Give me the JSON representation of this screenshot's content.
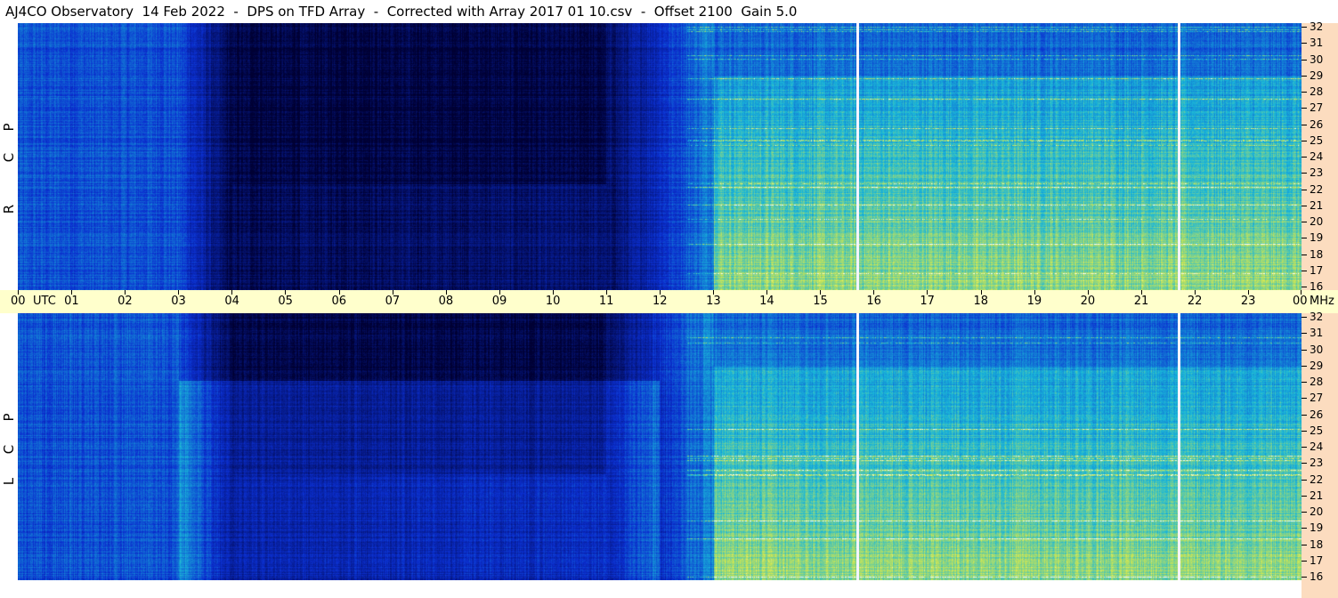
{
  "title": "AJ4CO Observatory  14 Feb 2022  -  DPS on TFD Array  -  Corrected with Array 2017 01 10.csv  -  Offset 2100  Gain 5.0",
  "chart_data": {
    "type": "heatmap",
    "panels": [
      {
        "name": "R C P",
        "letters": [
          "R",
          "C",
          "P"
        ]
      },
      {
        "name": "L C P",
        "letters": [
          "L",
          "C",
          "P"
        ]
      }
    ],
    "x_axis": {
      "ticks": [
        "00",
        "01",
        "02",
        "03",
        "04",
        "05",
        "06",
        "07",
        "08",
        "09",
        "10",
        "11",
        "12",
        "13",
        "14",
        "15",
        "16",
        "17",
        "18",
        "19",
        "20",
        "21",
        "22",
        "23",
        "00"
      ],
      "unit_label": "UTC",
      "range": [
        0,
        24
      ]
    },
    "y_axis": {
      "ticks": [
        "16",
        "17",
        "18",
        "19",
        "20",
        "21",
        "22",
        "23",
        "24",
        "25",
        "26",
        "27",
        "28",
        "29",
        "30",
        "31",
        "32"
      ],
      "unit_label": "MHz",
      "range": [
        16,
        32
      ]
    },
    "gaps_utc": [
      15.7,
      21.7
    ],
    "colors": {
      "quiet": "#000033",
      "low": "#0b2fd0",
      "mid": "#19b7d9",
      "high": "#d7e84a",
      "axis_bg": "#fcdcbf",
      "time_bg": "#ffffcc"
    }
  }
}
